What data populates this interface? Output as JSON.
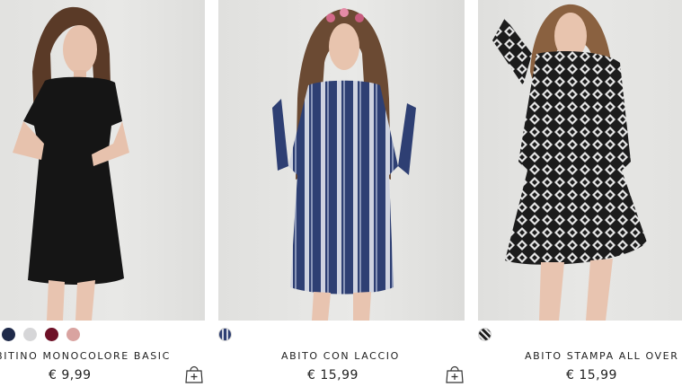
{
  "products": [
    {
      "name": "ABITINO MONOCOLORE BASIC",
      "price": "€ 9,99",
      "swatches": [
        "#1f2a4a",
        "#d6d6d8",
        "#6e1127",
        "#d9a3a0"
      ],
      "has_cart_icon": true
    },
    {
      "name": "ABITO CON LACCIO",
      "price": "€ 15,99",
      "swatches": [
        "pattern-blue"
      ],
      "has_cart_icon": true
    },
    {
      "name": "ABITO STAMPA ALL OVER",
      "price": "€ 15,99",
      "swatches": [
        "pattern-black-white"
      ],
      "has_cart_icon": false
    }
  ],
  "icons": {
    "cart": "shopping-bag-plus-icon"
  }
}
